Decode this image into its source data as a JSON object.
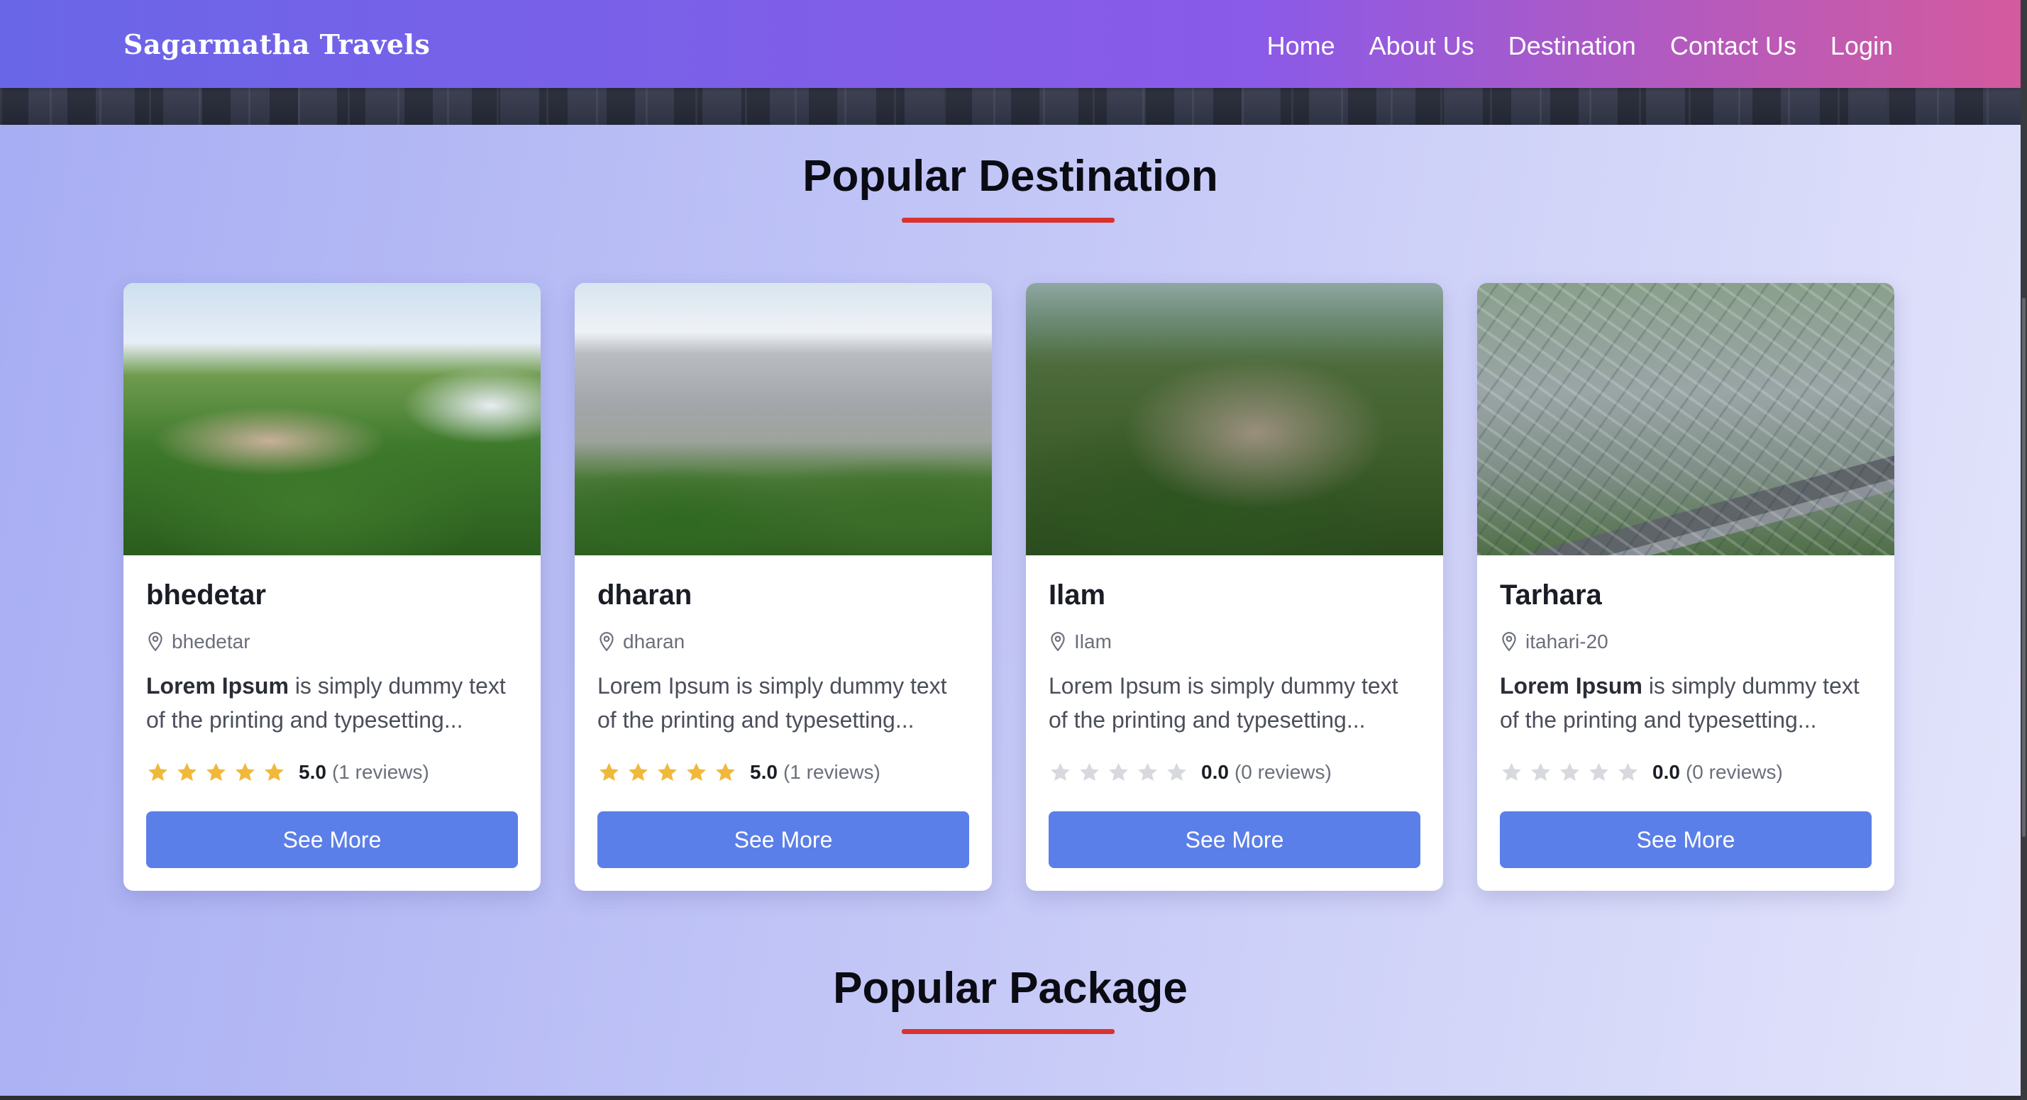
{
  "navbar": {
    "brand": "Sagarmatha Travels",
    "links": [
      "Home",
      "About Us",
      "Destination",
      "Contact Us",
      "Login"
    ]
  },
  "sections": {
    "destination_title": "Popular Destination",
    "package_title": "Popular Package"
  },
  "colors": {
    "star_filled": "#f0b93b",
    "star_empty": "#d7d9de",
    "button": "#5b7fe8",
    "underline": "#d9322f"
  },
  "cards": [
    {
      "title": "bhedetar",
      "location": "bhedetar",
      "desc_bold": "Lorem Ipsum",
      "desc_rest": " is simply dummy text of the printing and typesetting...",
      "rating": 5,
      "rating_value": "5.0",
      "rating_count": "(1 reviews)",
      "button": "See More"
    },
    {
      "title": "dharan",
      "location": "dharan",
      "desc_bold": "",
      "desc_rest": "Lorem Ipsum is simply dummy text of the printing and typesetting...",
      "rating": 5,
      "rating_value": "5.0",
      "rating_count": "(1 reviews)",
      "button": "See More"
    },
    {
      "title": "Ilam",
      "location": "Ilam",
      "desc_bold": "",
      "desc_rest": "Lorem Ipsum is simply dummy text of the printing and typesetting...",
      "rating": 0,
      "rating_value": "0.0",
      "rating_count": "(0 reviews)",
      "button": "See More"
    },
    {
      "title": "Tarhara",
      "location": "itahari-20",
      "desc_bold": "Lorem Ipsum",
      "desc_rest": " is simply dummy text of the printing and typesetting...",
      "rating": 0,
      "rating_value": "0.0",
      "rating_count": "(0 reviews)",
      "button": "See More"
    }
  ]
}
